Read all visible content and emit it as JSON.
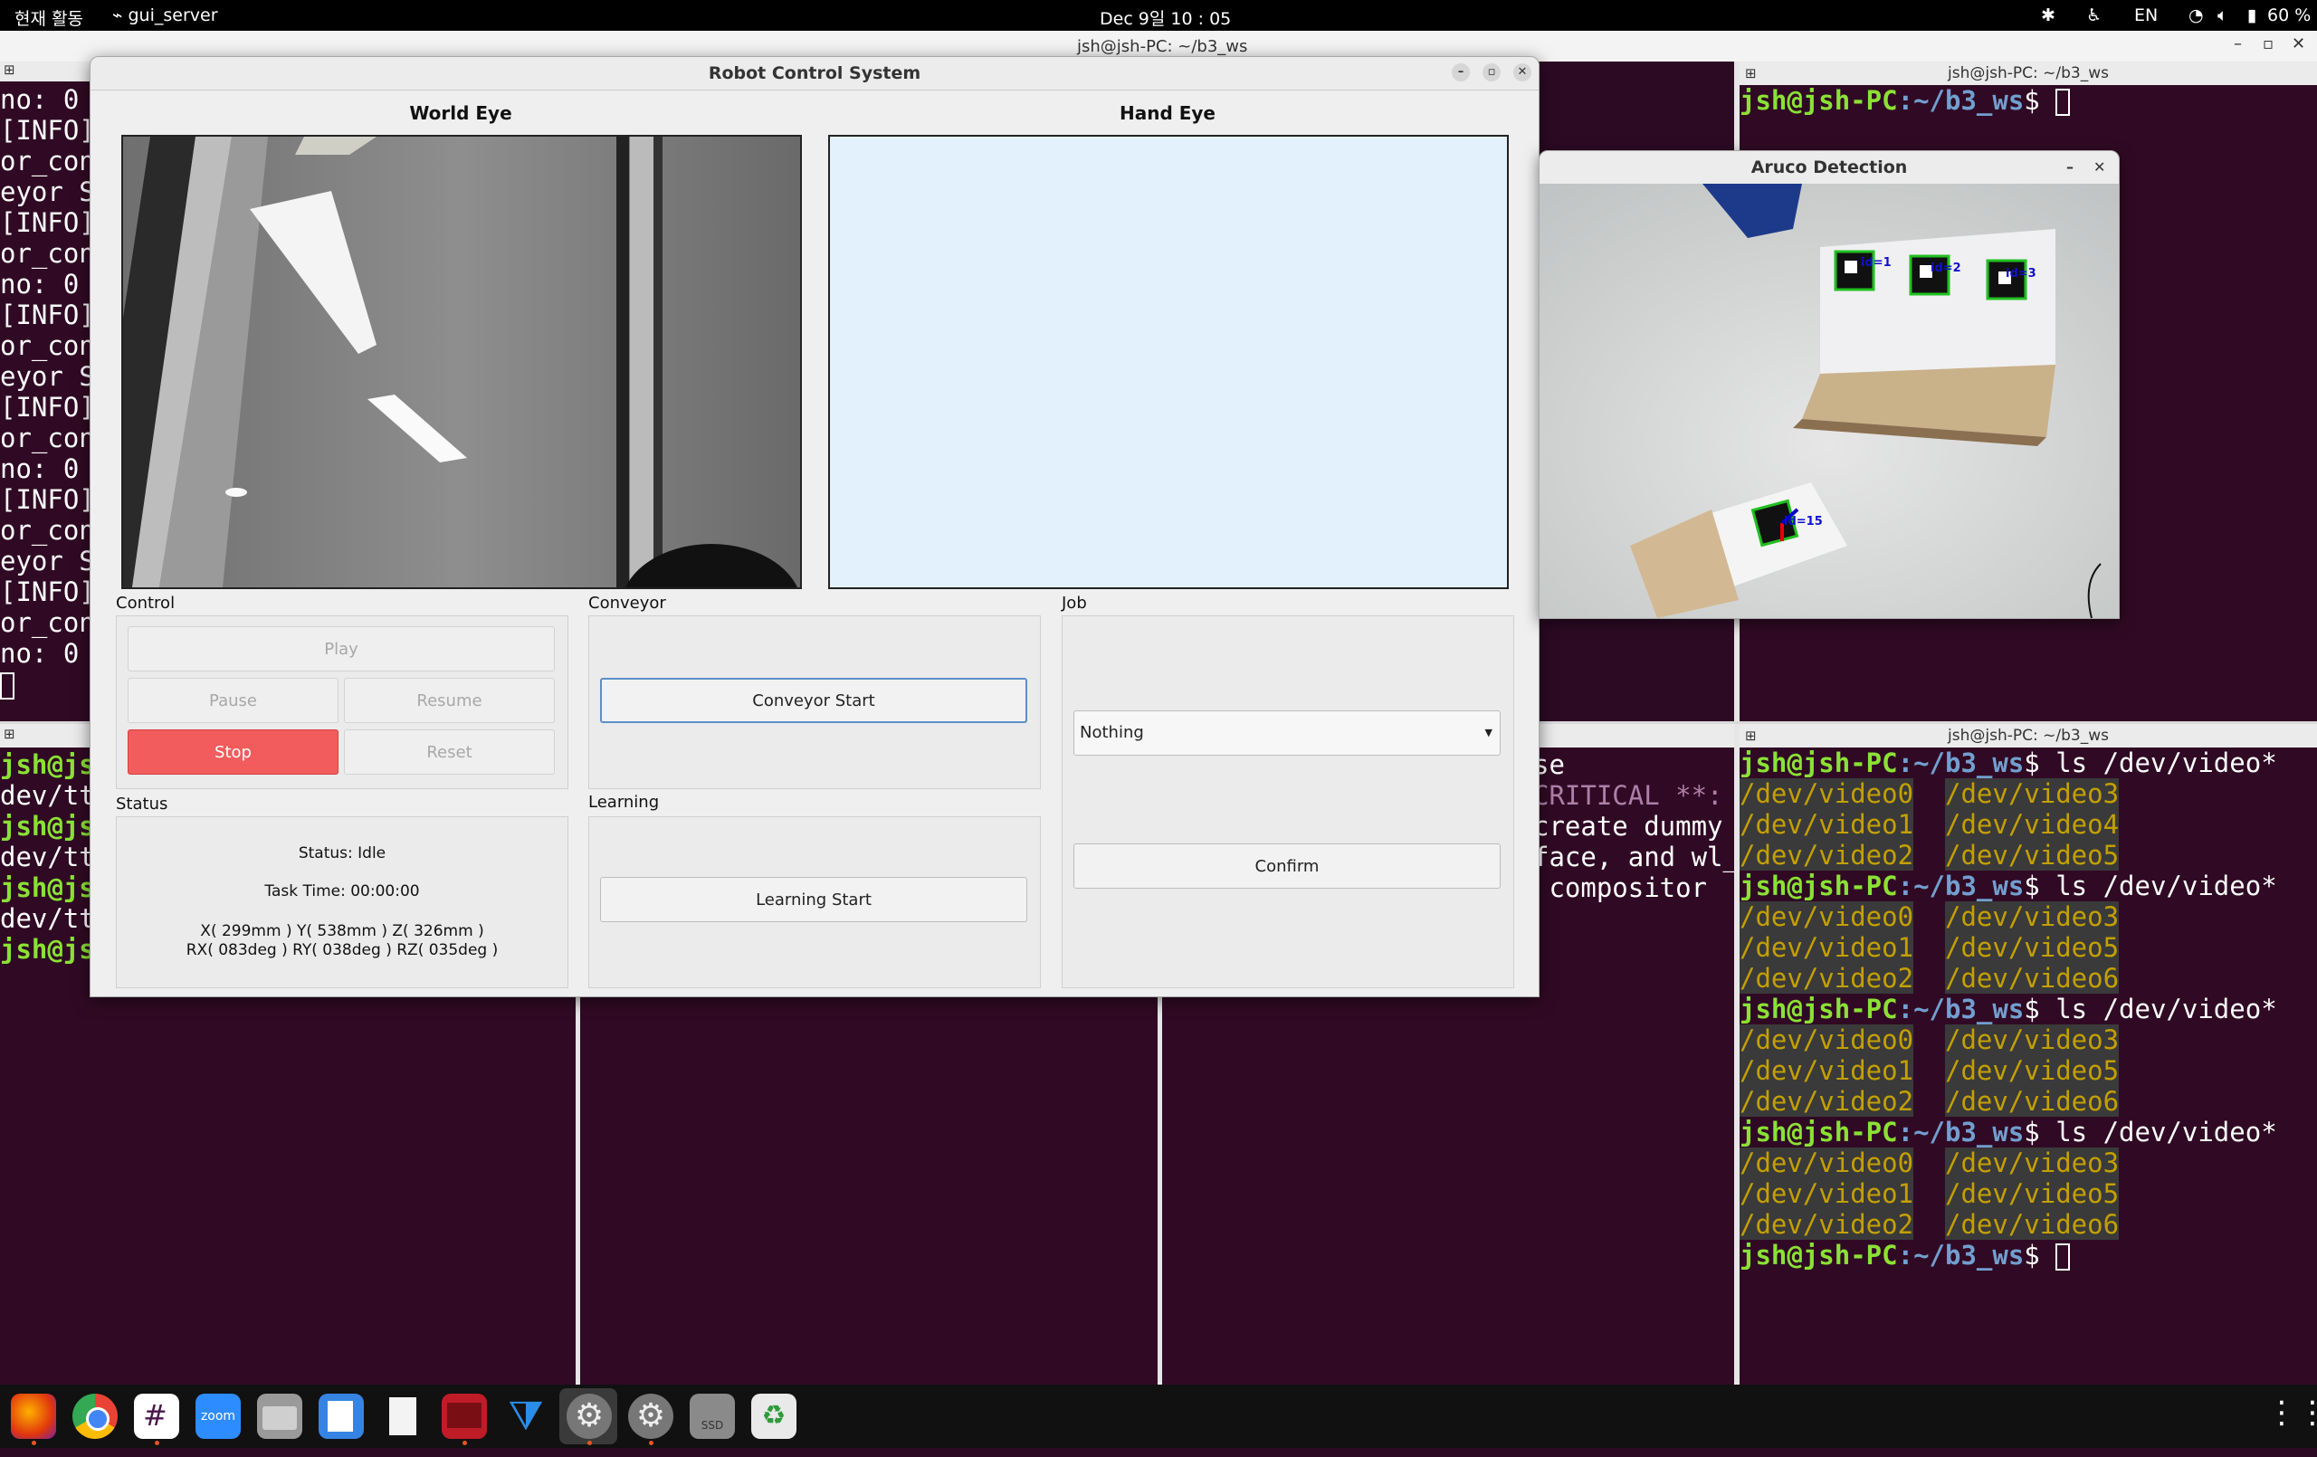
{
  "topbar": {
    "activities": "현재 활동",
    "app_name": "gui_server",
    "datetime": "Dec 9일  10 : 05",
    "language": "EN",
    "battery": "60 %"
  },
  "main_terminal_title": "jsh@jsh-PC: ~/b3_ws",
  "terminals": {
    "left_top_lines": [
      "no: 0",
      "[INFO]",
      "or_con",
      "eyor S",
      "[INFO]",
      "or_con",
      "no: 0",
      "[INFO]",
      "or_con",
      "eyor S",
      "[INFO]",
      "or_con",
      "no: 0",
      "[INFO]",
      "or_con",
      "eyor S",
      "[INFO]",
      "or_con",
      "no: 0"
    ],
    "left_bottom_lines": [
      "jsh@js",
      "dev/tt",
      "jsh@js",
      "dev/tt",
      "jsh@js",
      "dev/tt",
      "jsh@js"
    ],
    "right_top_title": "jsh@jsh-PC: ~/b3_ws",
    "right_bottom_title": "jsh@jsh-PC: ~/b3_ws",
    "prompt_user": "jsh@jsh-PC",
    "prompt_path": ":~/b3_ws",
    "prompt_dollar": "$",
    "command": " ls /dev/video*",
    "video_lists": [
      [
        "/dev/video0",
        "/dev/video3",
        "/dev/video1",
        "/dev/video4",
        "/dev/video2",
        "/dev/video5"
      ],
      [
        "/dev/video0",
        "/dev/video3",
        "/dev/video1",
        "/dev/video5",
        "/dev/video2",
        "/dev/video6"
      ],
      [
        "/dev/video0",
        "/dev/video3",
        "/dev/video1",
        "/dev/video5",
        "/dev/video2",
        "/dev/video6"
      ],
      [
        "/dev/video0",
        "/dev/video3",
        "/dev/video1",
        "/dev/video5",
        "/dev/video2",
        "/dev/video6"
      ]
    ],
    "middle_lines": [
      "se",
      "",
      "CRITICAL **:",
      "create dummy",
      "face, and wl_",
      " compositor"
    ]
  },
  "robot_window": {
    "title": "Robot Control System",
    "world_eye_title": "World Eye",
    "hand_eye_title": "Hand Eye",
    "control_label": "Control",
    "conveyor_label": "Conveyor",
    "job_label": "Job",
    "status_label": "Status",
    "learning_label": "Learning",
    "buttons": {
      "play": "Play",
      "pause": "Pause",
      "resume": "Resume",
      "stop": "Stop",
      "reset": "Reset",
      "conveyor_start": "Conveyor Start",
      "learning_start": "Learning Start",
      "confirm": "Confirm"
    },
    "job_select_value": "Nothing",
    "status_text": "Status: Idle",
    "task_time": "Task Time: 00:00:00",
    "pose_xyz": "X( 299mm )   Y( 538mm )   Z( 326mm )",
    "pose_rxyz": "RX( 083deg )   RY( 038deg )   RZ( 035deg )"
  },
  "aruco_window": {
    "title": "Aruco Detection",
    "markers": [
      "id=1",
      "id=2",
      "id=3",
      "id=15"
    ]
  },
  "dock_icons": [
    "firefox-icon",
    "chrome-icon",
    "slack-icon",
    "zoom-icon",
    "files-icon",
    "text-editor-icon",
    "document-icon",
    "screenshot-app-icon",
    "vscode-icon",
    "settings-icon",
    "settings-icon-2",
    "ssd-drive-icon",
    "trash-icon",
    "app-grid-icon"
  ],
  "dock_labels": {
    "zoom": "zoom",
    "ssd": "SSD"
  }
}
